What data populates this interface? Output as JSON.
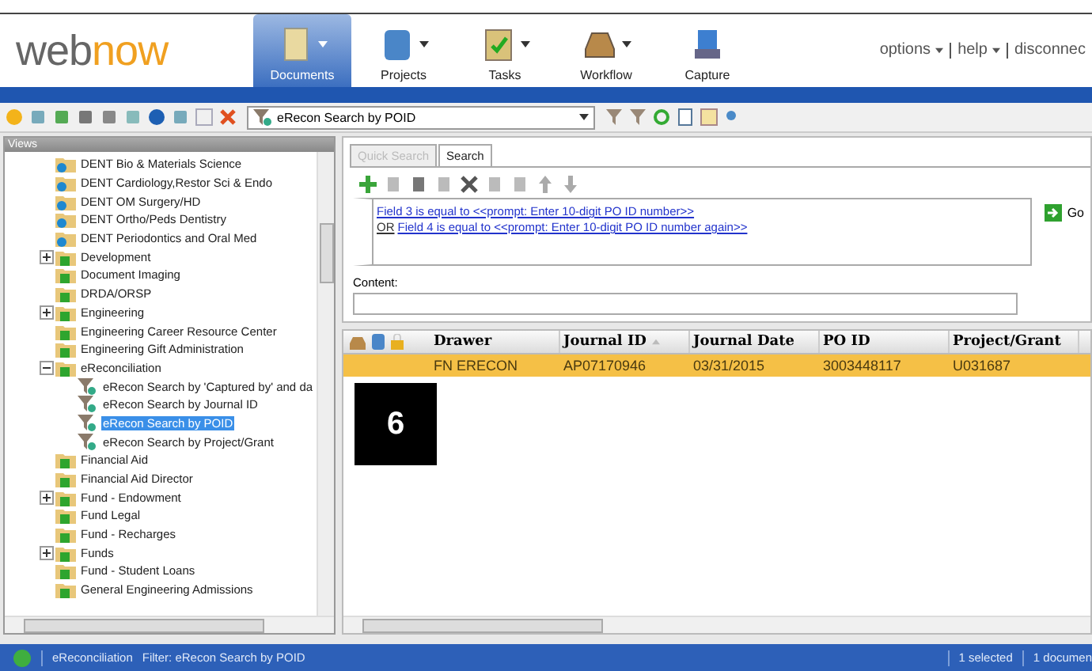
{
  "logo": {
    "first": "web",
    "second": "now"
  },
  "nav": [
    {
      "label": "Documents",
      "kind": "document",
      "has_menu": true,
      "selected": true
    },
    {
      "label": "Projects",
      "kind": "binder",
      "has_menu": true,
      "selected": false
    },
    {
      "label": "Tasks",
      "kind": "clipboard",
      "has_menu": true,
      "selected": false
    },
    {
      "label": "Workflow",
      "kind": "tray",
      "has_menu": true,
      "selected": false
    },
    {
      "label": "Capture",
      "kind": "scanner",
      "has_menu": false,
      "selected": false
    }
  ],
  "header_links": [
    {
      "label": "options",
      "has_menu": true
    },
    {
      "label": "help",
      "has_menu": true
    },
    {
      "label": "disconnec",
      "has_menu": false
    }
  ],
  "toolbar": {
    "search_select": "eRecon Search by POID"
  },
  "views": {
    "title": "Views",
    "tree": [
      {
        "label": "DENT Bio & Materials Science",
        "kind": "dept",
        "selected": false
      },
      {
        "label": "DENT Cardiology,Restor Sci & Endo",
        "kind": "dept",
        "selected": false
      },
      {
        "label": "DENT OM Surgery/HD",
        "kind": "dept",
        "selected": false
      },
      {
        "label": "DENT Ortho/Peds Dentistry",
        "kind": "dept",
        "selected": false
      },
      {
        "label": "DENT Periodontics and Oral Med",
        "kind": "dept",
        "selected": false
      },
      {
        "label": "Development",
        "kind": "folder",
        "selected": false,
        "expanded": false
      },
      {
        "label": "Document Imaging",
        "kind": "folder",
        "selected": false
      },
      {
        "label": "DRDA/ORSP",
        "kind": "folder",
        "selected": false
      },
      {
        "label": "Engineering",
        "kind": "folder",
        "selected": false,
        "expanded": false
      },
      {
        "label": "Engineering Career Resource Center",
        "kind": "folder",
        "selected": false
      },
      {
        "label": "Engineering Gift Administration",
        "kind": "folder",
        "selected": false
      },
      {
        "label": "eReconciliation",
        "kind": "folder",
        "selected": false,
        "expanded": true,
        "children": [
          {
            "label": "eRecon Search by 'Captured by' and da",
            "kind": "search",
            "selected": false
          },
          {
            "label": "eRecon Search by Journal ID",
            "kind": "search",
            "selected": false
          },
          {
            "label": "eRecon Search by POID",
            "kind": "search",
            "selected": true
          },
          {
            "label": "eRecon Search by Project/Grant",
            "kind": "search",
            "selected": false
          }
        ]
      },
      {
        "label": "Financial Aid",
        "kind": "folder",
        "selected": false
      },
      {
        "label": "Financial Aid Director",
        "kind": "folder",
        "selected": false
      },
      {
        "label": "Fund - Endowment",
        "kind": "folder",
        "selected": false,
        "expanded": false
      },
      {
        "label": "Fund Legal",
        "kind": "folder",
        "selected": false
      },
      {
        "label": "Fund - Recharges",
        "kind": "folder",
        "selected": false
      },
      {
        "label": "Funds",
        "kind": "folder",
        "selected": false,
        "expanded": false
      },
      {
        "label": "Fund - Student Loans",
        "kind": "folder",
        "selected": false
      },
      {
        "label": "General Engineering Admissions",
        "kind": "folder",
        "selected": false
      }
    ]
  },
  "search_panel": {
    "tabs": [
      {
        "label": "Quick Search",
        "selected": false,
        "disabled": true
      },
      {
        "label": "Search",
        "selected": true,
        "disabled": false
      }
    ],
    "criteria": [
      {
        "text": "Field 3 is equal to <<prompt: Enter 10-digit PO ID number>>"
      },
      {
        "connector": "OR",
        "text": "Field 4 is equal to <<prompt: Enter 10-digit PO ID number again>>"
      }
    ],
    "go_button": "Go",
    "content_label": "Content:"
  },
  "results": {
    "columns": [
      {
        "label": "Drawer",
        "sorted": false
      },
      {
        "label": "Journal ID",
        "sorted": true
      },
      {
        "label": "Journal Date",
        "sorted": false
      },
      {
        "label": "PO ID",
        "sorted": false
      },
      {
        "label": "Project/Grant",
        "sorted": false
      }
    ],
    "rows": [
      {
        "selected": true,
        "cells": [
          "FN ERECON",
          "AP07170946",
          "03/31/2015",
          "3003448117",
          "U031687"
        ]
      }
    ]
  },
  "annotation": "6",
  "status_bar": {
    "path": "eReconciliation",
    "filter": "Filter: eRecon Search by POID",
    "selected_count": "1 selected",
    "document_count": "1 documen"
  }
}
